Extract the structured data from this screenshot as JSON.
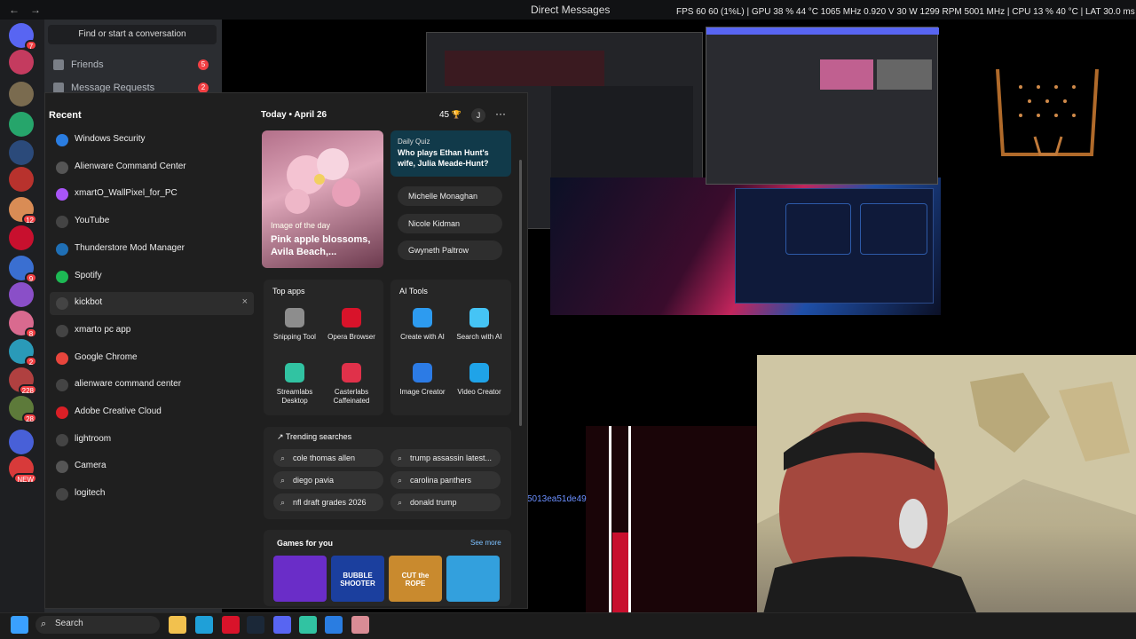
{
  "window": {
    "nav_back": "←",
    "nav_forward": "→",
    "title": "Direct Messages",
    "hud": "FPS  60  60 (1%L)  |  GPU 38 %  44 °C  1065 MHz  0.920 V  30 W  1299 RPM  5001 MHz  |  CPU 13 %  40 °C  |  LAT 30.0 ms  0 ms"
  },
  "servers": [
    {
      "name": "discord-home",
      "color": "#5865f2",
      "badge": "7"
    },
    {
      "name": "server-2",
      "color": "#c43b5f",
      "badge": ""
    },
    {
      "name": "server-3",
      "color": "#7a6b4f",
      "badge": ""
    },
    {
      "name": "server-4",
      "color": "#26a56b",
      "badge": ""
    },
    {
      "name": "server-ts",
      "color": "#2b4a7a",
      "badge": ""
    },
    {
      "name": "server-megabonk",
      "color": "#b8322d",
      "badge": ""
    },
    {
      "name": "server-7",
      "color": "#d98c55",
      "badge": "12"
    },
    {
      "name": "server-8",
      "color": "#c8102e",
      "badge": ""
    },
    {
      "name": "server-9",
      "color": "#3a6fd1",
      "badge": "9"
    },
    {
      "name": "server-10",
      "color": "#8a4fc8",
      "badge": ""
    },
    {
      "name": "server-11",
      "color": "#d96a8f",
      "badge": "8"
    },
    {
      "name": "server-12",
      "color": "#2a9ab8",
      "badge": "2"
    },
    {
      "name": "server-13",
      "color": "#b04040",
      "badge": "228"
    },
    {
      "name": "server-14",
      "color": "#5d7a3a",
      "badge": "28"
    },
    {
      "name": "server-15",
      "color": "#4860d8",
      "badge": ""
    },
    {
      "name": "server-new",
      "color": "#d83a3a",
      "badge": "NEW"
    }
  ],
  "dm": {
    "find_placeholder": "Find or start a conversation",
    "friends_label": "Friends",
    "friends_badge": "5",
    "requests_label": "Message Requests",
    "requests_badge": "2"
  },
  "start_menu": {
    "recent_title": "Recent",
    "recent": [
      {
        "label": "Windows Security",
        "icon": "shield-icon",
        "color": "#2a7de1"
      },
      {
        "label": "Alienware Command Center",
        "icon": "alienware-icon",
        "color": "#555555"
      },
      {
        "label": "xmartO_WallPixel_for_PC",
        "icon": "app-icon",
        "color": "#a855f7"
      },
      {
        "label": "YouTube",
        "icon": "search-icon",
        "color": "#444444"
      },
      {
        "label": "Thunderstore Mod Manager",
        "icon": "thunderstore-icon",
        "color": "#1f6fb5"
      },
      {
        "label": "Spotify",
        "icon": "spotify-icon",
        "color": "#1db954"
      },
      {
        "label": "kickbot",
        "icon": "search-icon",
        "color": "#444444"
      },
      {
        "label": "xmarto pc app",
        "icon": "search-icon",
        "color": "#444444"
      },
      {
        "label": "Google Chrome",
        "icon": "chrome-icon",
        "color": "#e8453c"
      },
      {
        "label": "alienware command center",
        "icon": "search-icon",
        "color": "#444444"
      },
      {
        "label": "Adobe Creative Cloud",
        "icon": "creative-cloud-icon",
        "color": "#da1f26"
      },
      {
        "label": "lightroom",
        "icon": "search-icon",
        "color": "#444444"
      },
      {
        "label": "Camera",
        "icon": "camera-icon",
        "color": "#555555"
      },
      {
        "label": "logitech",
        "icon": "search-icon",
        "color": "#444444"
      }
    ],
    "remove_glyph": "×",
    "today_label": "Today  •  April 26",
    "points": "45",
    "trophy_glyph": "🏆",
    "avatar_letter": "J",
    "more_glyph": "···",
    "image_of_day": {
      "caption": "Image of the day",
      "title": "Pink apple blossoms, Avila Beach,..."
    },
    "quiz": {
      "tag": "Daily Quiz",
      "question": "Who plays Ethan Hunt's wife, Julia Meade-Hunt?",
      "answers": [
        "Michelle Monaghan",
        "Nicole Kidman",
        "Gwyneth Paltrow"
      ]
    },
    "top_apps_title": "Top apps",
    "top_apps": [
      {
        "label": "Snipping Tool",
        "color": "#8d8d8d"
      },
      {
        "label": "Opera Browser",
        "color": "#d8132a"
      },
      {
        "label": "Streamlabs Desktop",
        "color": "#31c3a2"
      },
      {
        "label": "Casterlabs Caffeinated",
        "color": "#e0314a"
      }
    ],
    "ai_tools_title": "AI Tools",
    "ai_tools": [
      {
        "label": "Create with AI",
        "color": "#2d9bf0"
      },
      {
        "label": "Search with AI",
        "color": "#45c4f5"
      },
      {
        "label": "Image Creator",
        "color": "#2c7be5"
      },
      {
        "label": "Video Creator",
        "color": "#1fa3e8"
      }
    ],
    "trending_title": "Trending searches",
    "trending_glyph": "↗",
    "search_glyph": "⌕",
    "trending": [
      "cole thomas allen",
      "trump assassin latest...",
      "diego pavia",
      "carolina panthers",
      "nfl draft grades 2026",
      "donald trump"
    ],
    "games_title": "Games for you",
    "see_more": "See more",
    "games": [
      {
        "name": "arrow-game",
        "color": "#6a2dc8",
        "label": ""
      },
      {
        "name": "bubble-shooter",
        "color": "#1b3f9e",
        "label": "BUBBLE SHOOTER"
      },
      {
        "name": "cut-the-rope",
        "color": "#c98a2e",
        "label": "CUT the ROPE"
      },
      {
        "name": "runner-game",
        "color": "#33a0dd",
        "label": ""
      }
    ]
  },
  "red_panel_hash": "5013ea51de49",
  "taskbar": {
    "search_placeholder": "Search",
    "icons": [
      {
        "name": "start-icon",
        "color": "#3aa0ff"
      },
      {
        "name": "file-explorer-icon",
        "color": "#f2c14e"
      },
      {
        "name": "edge-icon",
        "color": "#1fa0d8"
      },
      {
        "name": "opera-icon",
        "color": "#d8132a"
      },
      {
        "name": "steam-icon",
        "color": "#1b2838"
      },
      {
        "name": "discord-icon",
        "color": "#5865f2"
      },
      {
        "name": "streamlabs-icon",
        "color": "#31c3a2"
      },
      {
        "name": "photos-icon",
        "color": "#2a7de1"
      },
      {
        "name": "app-icon",
        "color": "#d98c95"
      }
    ]
  }
}
